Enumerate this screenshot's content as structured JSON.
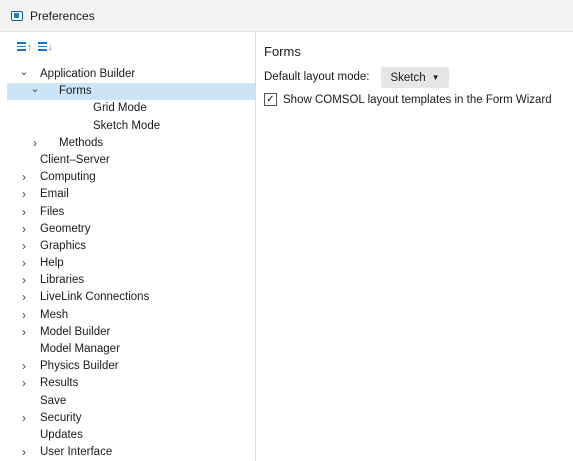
{
  "window": {
    "title": "Preferences",
    "icon": "comsol-app-icon"
  },
  "toolbar": {
    "buttons": [
      "expand-all-icon",
      "collapse-all-icon"
    ]
  },
  "tree": [
    {
      "label": "Application Builder",
      "depth": 0,
      "expander": "expanded",
      "selected": false
    },
    {
      "label": "Forms",
      "depth": 1,
      "expander": "expanded",
      "selected": true
    },
    {
      "label": "Grid Mode",
      "depth": 2,
      "expander": "none",
      "selected": false
    },
    {
      "label": "Sketch Mode",
      "depth": 2,
      "expander": "none",
      "selected": false
    },
    {
      "label": "Methods",
      "depth": 1,
      "expander": "collapsed",
      "selected": false
    },
    {
      "label": "Client–Server",
      "depth": 0,
      "expander": "none",
      "selected": false
    },
    {
      "label": "Computing",
      "depth": 0,
      "expander": "collapsed",
      "selected": false
    },
    {
      "label": "Email",
      "depth": 0,
      "expander": "collapsed",
      "selected": false
    },
    {
      "label": "Files",
      "depth": 0,
      "expander": "collapsed",
      "selected": false
    },
    {
      "label": "Geometry",
      "depth": 0,
      "expander": "collapsed",
      "selected": false
    },
    {
      "label": "Graphics",
      "depth": 0,
      "expander": "collapsed",
      "selected": false
    },
    {
      "label": "Help",
      "depth": 0,
      "expander": "collapsed",
      "selected": false
    },
    {
      "label": "Libraries",
      "depth": 0,
      "expander": "collapsed",
      "selected": false
    },
    {
      "label": "LiveLink Connections",
      "depth": 0,
      "expander": "collapsed",
      "selected": false
    },
    {
      "label": "Mesh",
      "depth": 0,
      "expander": "collapsed",
      "selected": false
    },
    {
      "label": "Model Builder",
      "depth": 0,
      "expander": "collapsed",
      "selected": false
    },
    {
      "label": "Model Manager",
      "depth": 0,
      "expander": "none",
      "selected": false
    },
    {
      "label": "Physics Builder",
      "depth": 0,
      "expander": "collapsed",
      "selected": false
    },
    {
      "label": "Results",
      "depth": 0,
      "expander": "collapsed",
      "selected": false
    },
    {
      "label": "Save",
      "depth": 0,
      "expander": "none",
      "selected": false
    },
    {
      "label": "Security",
      "depth": 0,
      "expander": "collapsed",
      "selected": false
    },
    {
      "label": "Updates",
      "depth": 0,
      "expander": "none",
      "selected": false
    },
    {
      "label": "User Interface",
      "depth": 0,
      "expander": "collapsed",
      "selected": false
    }
  ],
  "panel": {
    "title": "Forms",
    "layout_mode_label": "Default layout mode:",
    "layout_mode_value": "Sketch",
    "templates_checkbox_label": "Show COMSOL layout templates in the Form Wizard",
    "templates_checked": true
  },
  "colors": {
    "selection": "#cce4f7",
    "accent": "#1a73c9"
  }
}
